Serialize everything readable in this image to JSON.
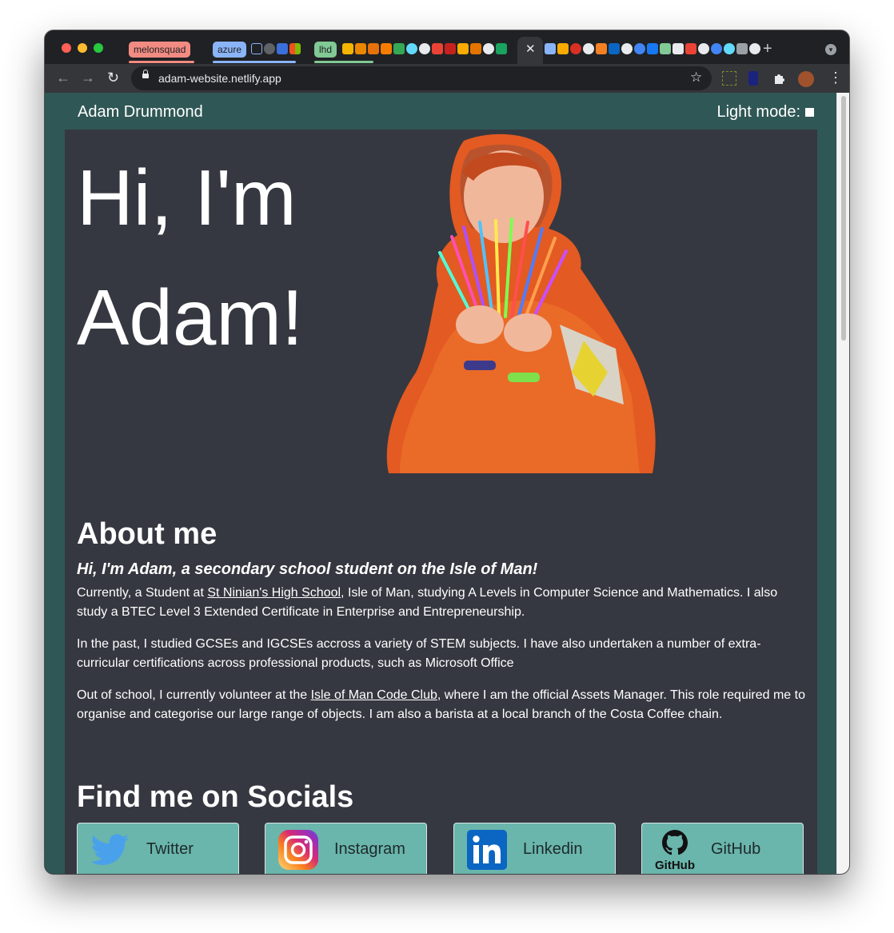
{
  "browser": {
    "tab_groups": [
      {
        "label": "melonsquad",
        "color": "#f28b82"
      },
      {
        "label": "azure",
        "color": "#8ab4f8"
      },
      {
        "label": "lhd",
        "color": "#81c995"
      }
    ],
    "url": "adam-website.netlify.app",
    "new_tab_symbol": "+",
    "close_symbol": "✕",
    "back_symbol": "←",
    "forward_symbol": "→",
    "reload_symbol": "↻",
    "star_symbol": "☆",
    "menu_symbol": "⋮"
  },
  "site": {
    "brand": "Adam Drummond",
    "light_mode_label": "Light mode:",
    "hero": {
      "line1": "Hi, I'm",
      "line2": "Adam!"
    },
    "about": {
      "heading": "About me",
      "subheading": "Hi, I'm Adam, a secondary school student on the Isle of Man!",
      "p1_before": "Currently, a Student at ",
      "p1_link": "St Ninian's High School",
      "p1_after": ", Isle of Man, studying A Levels in Computer Science and Mathematics. I also study a BTEC Level 3 Extended Certificate in Enterprise and Entrepreneurship.",
      "p2": "In the past, I studied GCSEs and IGCSEs accross a variety of STEM subjects. I have also undertaken a number of extra-curricular certifications across professional products, such as Microsoft Office",
      "p3_before": "Out of school, I currently volunteer at the ",
      "p3_link": "Isle of Man Code Club",
      "p3_after": ", where I am the official Assets Manager. This role required me to organise and categorise our large range of objects. I am also a barista at a local branch of the Costa Coffee chain."
    },
    "socials": {
      "heading": "Find me on Socials",
      "items": [
        {
          "label": "Twitter",
          "icon": "twitter-icon"
        },
        {
          "label": "Instagram",
          "icon": "instagram-icon"
        },
        {
          "label": "Linkedin",
          "icon": "linkedin-icon"
        },
        {
          "label": "GitHub",
          "icon": "github-icon",
          "logo_text": "GitHub"
        }
      ]
    }
  },
  "colors": {
    "page_bg": "#2f5755",
    "content_bg": "#353840",
    "social_card": "#6ab5ac"
  }
}
